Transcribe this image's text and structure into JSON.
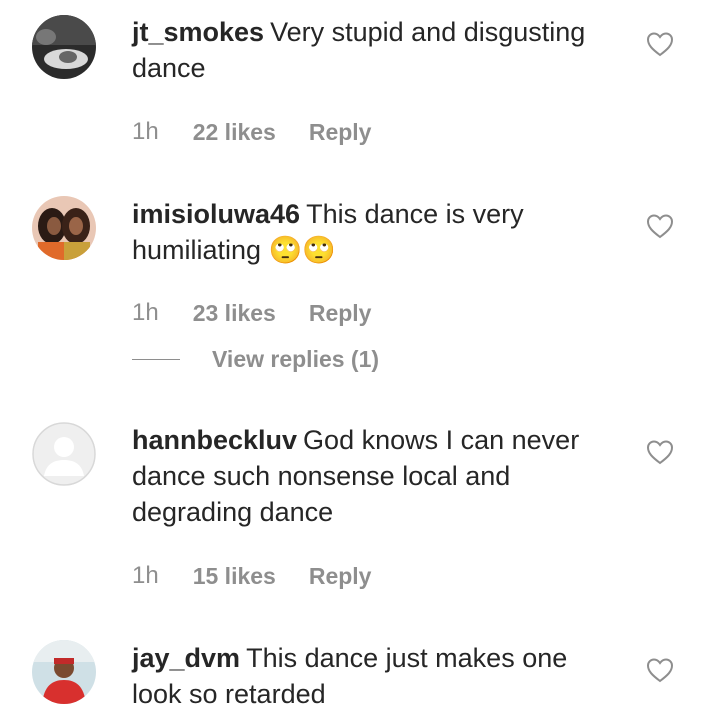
{
  "comments": [
    {
      "username": "jt_smokes",
      "text": "Very stupid and disgusting dance",
      "time": "1h",
      "likes": "22 likes",
      "reply": "Reply"
    },
    {
      "username": "imisioluwa46",
      "text": "This dance is very humiliating 🙄🙄",
      "time": "1h",
      "likes": "23 likes",
      "reply": "Reply",
      "view_replies": "View replies (1)"
    },
    {
      "username": "hannbeckluv",
      "text": "God knows I can never dance such nonsense local and degrading dance",
      "time": "1h",
      "likes": "15 likes",
      "reply": "Reply"
    },
    {
      "username": "jay_dvm",
      "text": "This dance just makes one look so retarded"
    }
  ],
  "icons": {
    "like": "heart-outline-icon",
    "avatar_placeholder": "default-user-icon"
  },
  "colors": {
    "text": "#262626",
    "muted": "#8e8e8e"
  }
}
